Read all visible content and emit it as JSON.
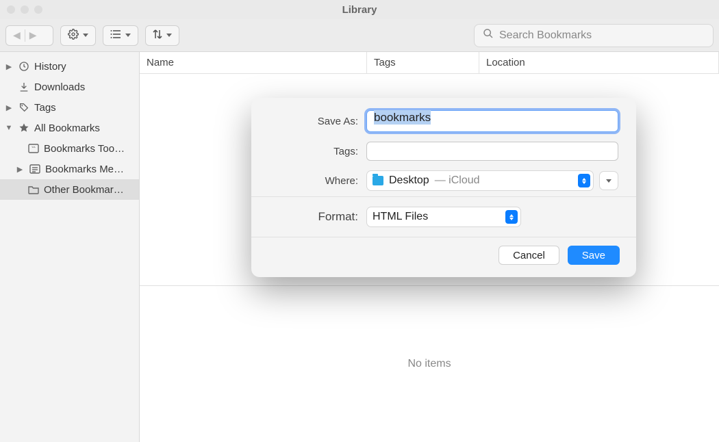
{
  "window": {
    "title": "Library"
  },
  "toolbar": {
    "search_placeholder": "Search Bookmarks"
  },
  "sidebar": {
    "items": [
      {
        "label": "History",
        "icon": "clock-icon",
        "has_children": true,
        "expanded": false
      },
      {
        "label": "Downloads",
        "icon": "download-icon"
      },
      {
        "label": "Tags",
        "icon": "tag-icon",
        "has_children": true,
        "expanded": false
      },
      {
        "label": "All Bookmarks",
        "icon": "star-filled-icon",
        "has_children": true,
        "expanded": true,
        "children": [
          {
            "label": "Bookmarks Too…",
            "icon": "bookmark-toolbar-icon"
          },
          {
            "label": "Bookmarks Me…",
            "icon": "bookmark-menu-icon",
            "has_children": true,
            "expanded": false
          },
          {
            "label": "Other Bookmar…",
            "icon": "folder-icon",
            "selected": true
          }
        ]
      }
    ]
  },
  "columns": {
    "name": "Name",
    "tags": "Tags",
    "location": "Location"
  },
  "detail": {
    "empty_message": "No items"
  },
  "dialog": {
    "save_as_label": "Save As:",
    "save_as_value": "bookmarks",
    "tags_label": "Tags:",
    "tags_value": "",
    "where_label": "Where:",
    "where_folder": "Desktop",
    "where_suffix": " — iCloud",
    "format_label": "Format:",
    "format_value": "HTML Files",
    "cancel": "Cancel",
    "save": "Save"
  }
}
